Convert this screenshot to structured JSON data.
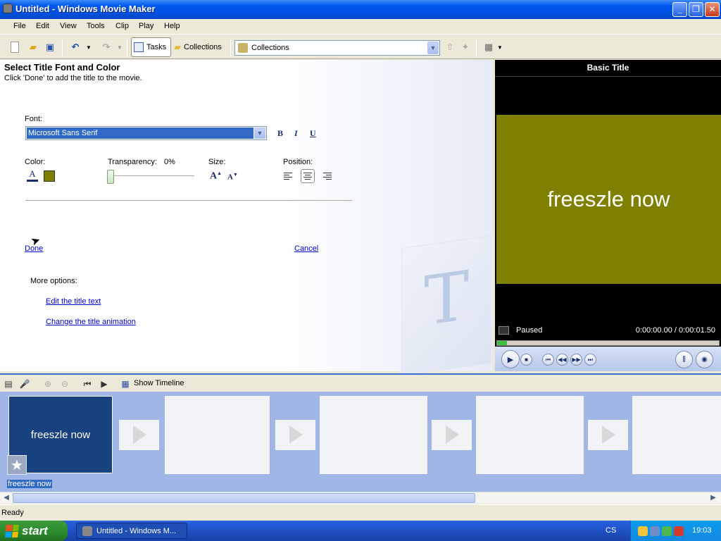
{
  "window": {
    "title": "Untitled - Windows Movie Maker"
  },
  "menu": [
    "File",
    "Edit",
    "View",
    "Tools",
    "Clip",
    "Play",
    "Help"
  ],
  "toolbar": {
    "tasks_label": "Tasks",
    "collections_label": "Collections",
    "collections_select": "Collections"
  },
  "task": {
    "title": "Select Title Font and Color",
    "subtitle": "Click 'Done' to add the title to the movie.",
    "font_label": "Font:",
    "font_value": "Microsoft Sans Serif",
    "bold": "B",
    "italic": "I",
    "underline": "U",
    "color_label": "Color:",
    "color_value": "#808000",
    "transparency_label": "Transparency:",
    "transparency_value": "0%",
    "size_label": "Size:",
    "position_label": "Position:",
    "done": "Done",
    "cancel": "Cancel",
    "more_options": "More options:",
    "links": [
      "Edit the title text",
      "Change the title animation"
    ]
  },
  "preview": {
    "title": "Basic Title",
    "frame_text": "freeszle now",
    "frame_color": "#808000",
    "status": "Paused",
    "time": "0:00:00.00 / 0:00:01.50"
  },
  "storyboard": {
    "show_timeline": "Show Timeline",
    "clip_text": "freeszle now",
    "clip_label": "freeszle now"
  },
  "status_bar": {
    "text": "Ready"
  },
  "taskbar": {
    "start": "start",
    "task_item": "Untitled - Windows M...",
    "language": "CS",
    "clock": "19:03"
  }
}
